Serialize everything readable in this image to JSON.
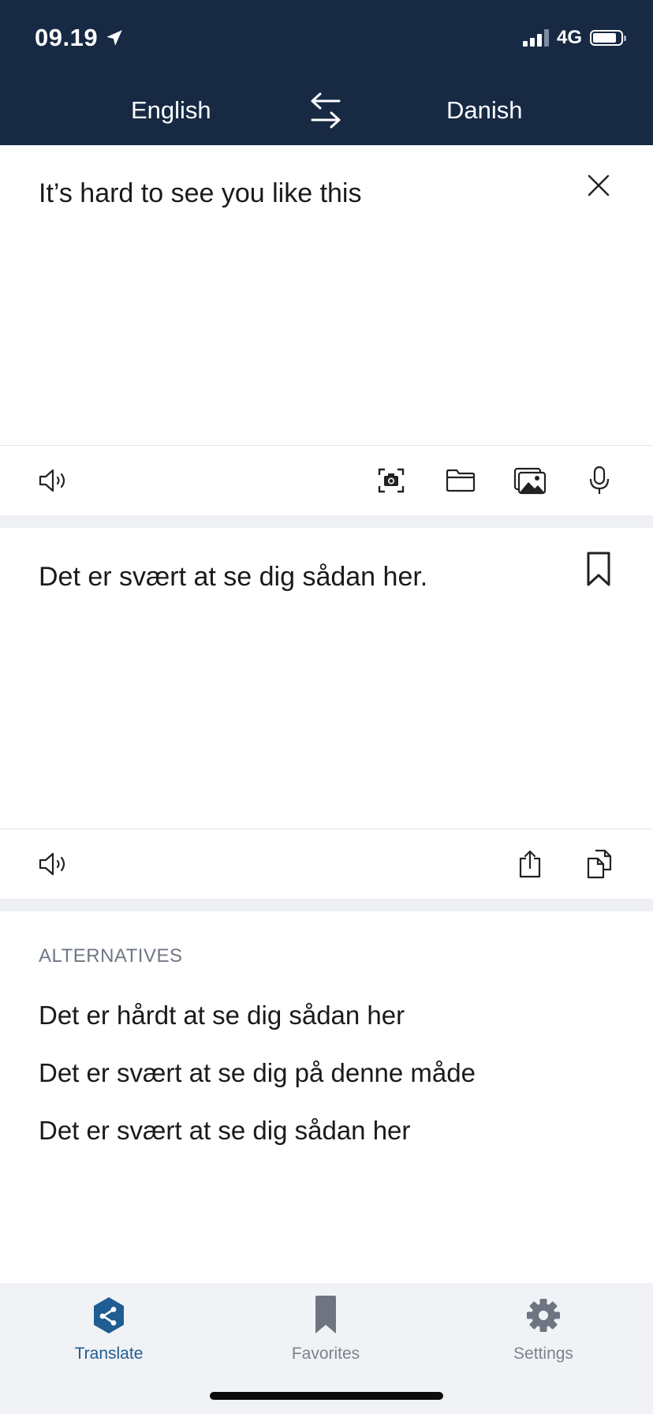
{
  "status_bar": {
    "time": "09.19",
    "network": "4G",
    "location_icon": "location-arrow-icon"
  },
  "header": {
    "source_language": "English",
    "target_language": "Danish",
    "swap_icon": "swap-arrows-icon"
  },
  "source": {
    "text": "It’s hard to see you like this",
    "clear_icon": "close-icon",
    "toolbar": [
      "speaker-icon",
      "camera-icon",
      "folder-icon",
      "photos-icon",
      "microphone-icon"
    ]
  },
  "target": {
    "text": "Det er svært at se dig sådan her.",
    "bookmark_icon": "bookmark-icon",
    "toolbar": [
      "speaker-icon",
      "share-icon",
      "copy-icon"
    ]
  },
  "alternatives": {
    "heading": "ALTERNATIVES",
    "items": [
      "Det er hårdt at se dig sådan her",
      "Det er svært at se dig på denne måde",
      "Det er svært at se dig sådan her"
    ]
  },
  "tabbar": {
    "tabs": [
      {
        "label": "Translate",
        "icon": "translate-logo-icon",
        "active": true
      },
      {
        "label": "Favorites",
        "icon": "bookmark-icon",
        "active": false
      },
      {
        "label": "Settings",
        "icon": "gear-icon",
        "active": false
      }
    ]
  },
  "colors": {
    "header_bg": "#172943",
    "accent": "#1f5d93",
    "muted": "#7c828c",
    "band": "#eef0f4"
  }
}
